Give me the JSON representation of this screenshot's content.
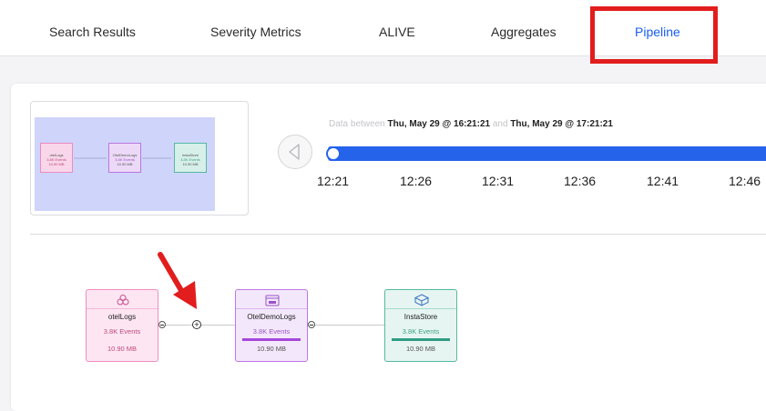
{
  "tabs": [
    {
      "label": "Search Results"
    },
    {
      "label": "Severity Metrics"
    },
    {
      "label": "ALIVE"
    },
    {
      "label": "Aggregates"
    },
    {
      "label": "Pipeline",
      "active": true
    }
  ],
  "timeline": {
    "prefix": "Data between",
    "start": "Thu, May 29 @ 16:21:21",
    "joiner": "and",
    "end": "Thu, May 29 @ 17:21:21",
    "ticks": [
      "12:21",
      "12:26",
      "12:31",
      "12:36",
      "12:41",
      "12:46"
    ]
  },
  "pipeline": {
    "nodes": [
      {
        "name": "otelLogs",
        "events": "3.8K Events",
        "size": "10.90 MB",
        "icon": "source-icon"
      },
      {
        "name": "OtelDemoLogs",
        "events": "3.8K Events",
        "size": "10.90 MB",
        "icon": "app-icon"
      },
      {
        "name": "InstaStore",
        "events": "3.8K Events",
        "size": "10.90 MB",
        "icon": "cube-icon"
      }
    ]
  },
  "minimap": {
    "nodes": [
      {
        "name": "otelLogs",
        "events": "3.8K Events",
        "size": "10.90 MB"
      },
      {
        "name": "OtelDemoLogs",
        "events": "3.8K Events",
        "size": "10.90 MB"
      },
      {
        "name": "InstaStore",
        "events": "3.8K Events",
        "size": "10.90 MB"
      }
    ]
  },
  "colors": {
    "accent": "#1a5cf5",
    "highlight": "#e21d1d",
    "annotation_arrow": "#e21d1d"
  }
}
